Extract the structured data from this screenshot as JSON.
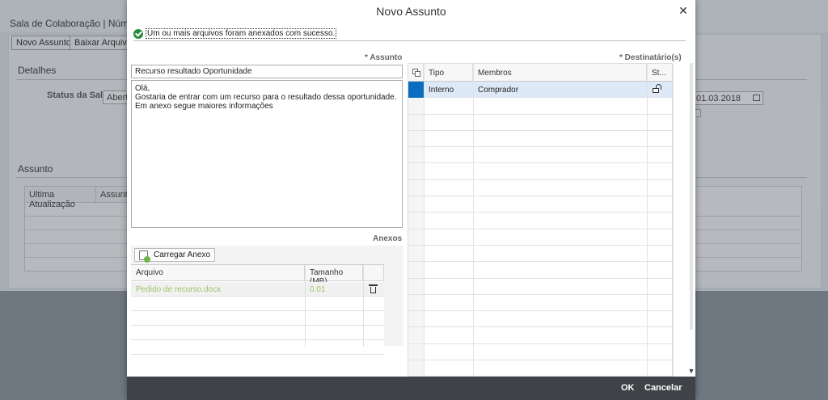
{
  "background": {
    "window_title": "Sala de Colaboração | Número",
    "buttons": {
      "new_subject": "Novo Assunto",
      "download_files": "Baixar Arquivos"
    },
    "sections": {
      "details": "Detalhes",
      "subject": "Assunto"
    },
    "status_label": "Status da Sala",
    "status_value": "Aberta",
    "date_value": "01.03.2018",
    "table_headers": [
      "Ultima Atualização",
      "Assunto"
    ]
  },
  "dialog": {
    "title": "Novo Assunto",
    "close_icon": "close-icon",
    "success_message": "Um ou mais arquivos foram anexados com sucesso.",
    "subject_label": "Assunto",
    "subject_value": "Recurso resultado Oportunidade",
    "body_value": "Olá,\nGostaria de entrar com um recurso para o resultado dessa oportunidade. Em anexo segue maiores informações",
    "attachments": {
      "label": "Anexos",
      "upload_button": "Carregar Anexo",
      "headers": {
        "file": "Arquivo",
        "size": "Tamanho (MB)"
      },
      "rows": [
        {
          "file": "Pedido de recurso.docx",
          "size": "0.01"
        }
      ]
    },
    "recipients": {
      "label": "Destinatário(s)",
      "headers": {
        "type": "Tipo",
        "members": "Membros",
        "status": "St..."
      },
      "rows": [
        {
          "type": "Interno",
          "members": "Comprador"
        }
      ]
    },
    "footer": {
      "ok": "OK",
      "cancel": "Cancelar"
    }
  },
  "colors": {
    "footer_bg": "#3f4347",
    "selected_row": "#0a6dc0",
    "success_green": "#2a8a3a",
    "attachment_text": "#9bc56a"
  }
}
